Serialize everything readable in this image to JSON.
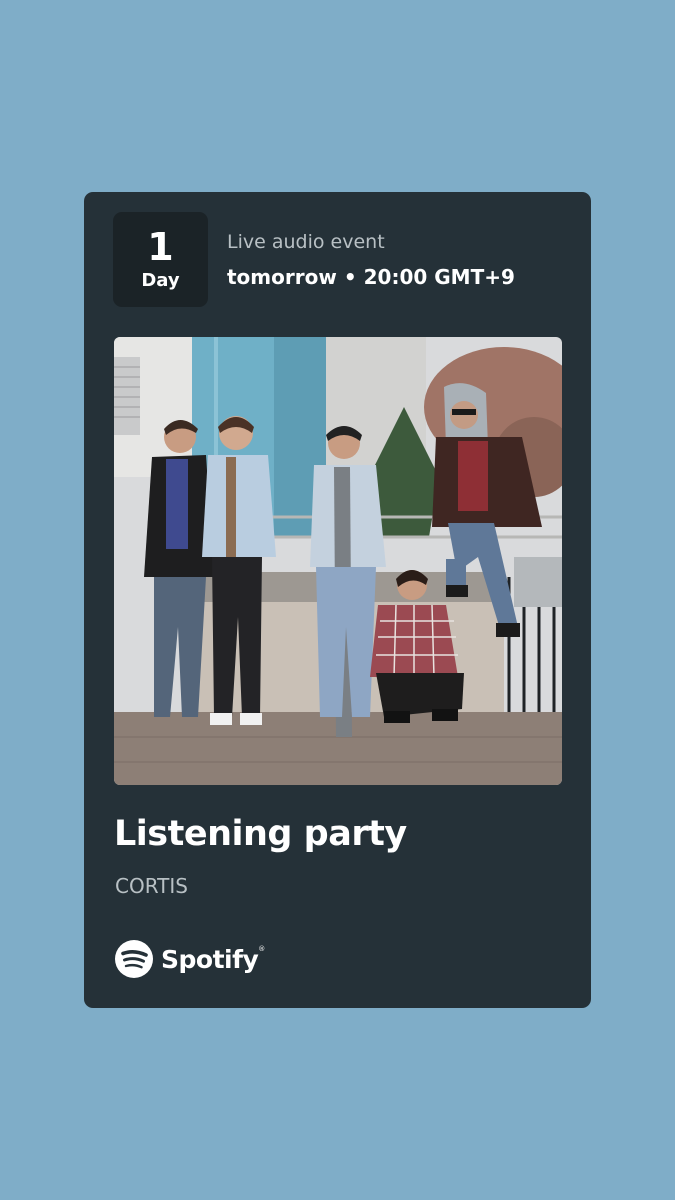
{
  "colors": {
    "background": "#7fadc8",
    "card": "#253138",
    "day_box": "#1b2327",
    "muted_text": "#b8c0c4",
    "text": "#ffffff"
  },
  "countdown": {
    "number": "1",
    "unit": "Day"
  },
  "event": {
    "type": "Live audio event",
    "day": "tomorrow",
    "separator": "•",
    "time": "20:00 GMT+9"
  },
  "photo": {
    "description_icon": "group-photo-image"
  },
  "title": "Listening party",
  "artist": "CORTIS",
  "brand": {
    "name": "Spotify",
    "trademark": "®",
    "icon": "spotify-logo-icon"
  }
}
